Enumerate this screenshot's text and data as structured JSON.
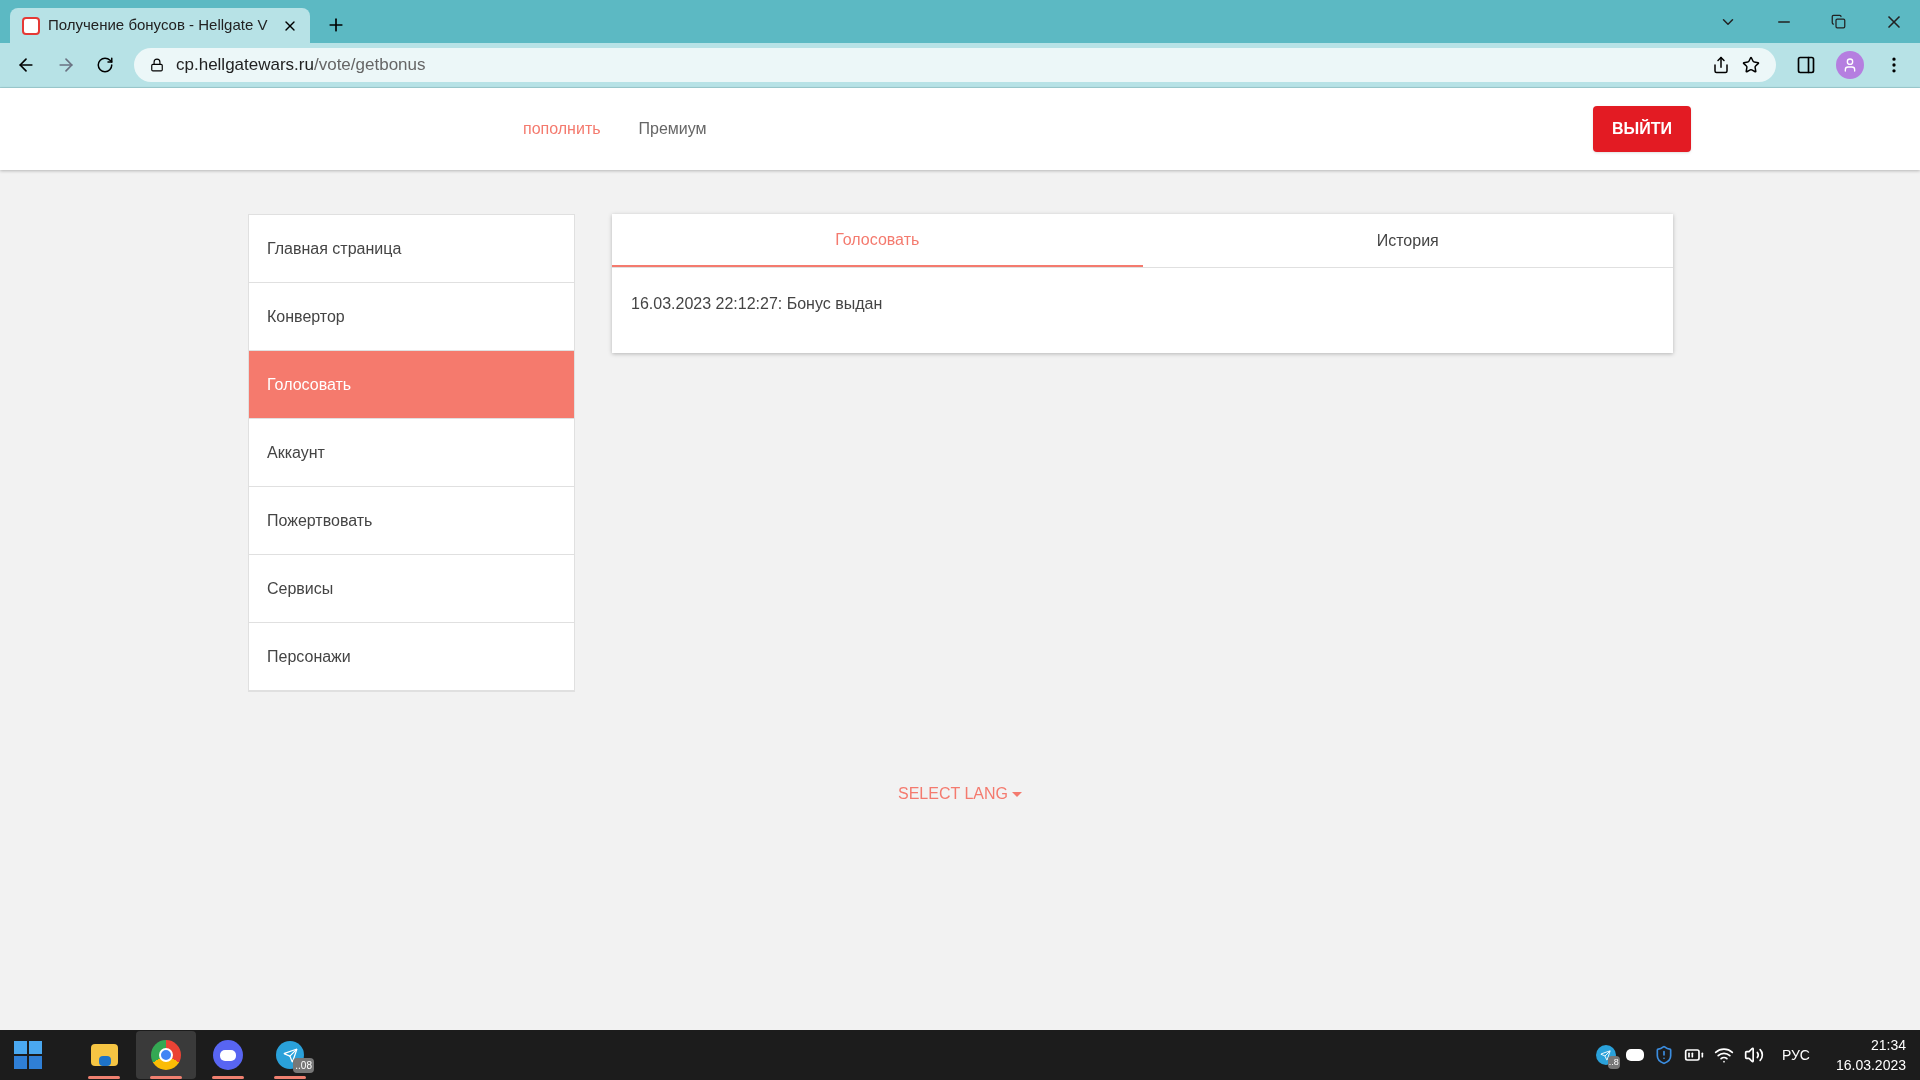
{
  "browser": {
    "tab_title": "Получение бонусов - Hellgate V",
    "url_host": "cp.hellgatewars.ru",
    "url_path": "/vote/getbonus"
  },
  "header": {
    "nav": [
      {
        "label": "пополнить",
        "selected": true
      },
      {
        "label": "Премиум",
        "selected": false
      }
    ],
    "logout": "ВЫЙТИ"
  },
  "sidebar": {
    "items": [
      {
        "label": "Главная страница",
        "selected": false
      },
      {
        "label": "Конвертор",
        "selected": false
      },
      {
        "label": "Голосовать",
        "selected": true
      },
      {
        "label": "Аккаунт",
        "selected": false
      },
      {
        "label": "Пожертвовать",
        "selected": false
      },
      {
        "label": "Сервисы",
        "selected": false
      },
      {
        "label": "Персонажи",
        "selected": false
      }
    ]
  },
  "content": {
    "tabs": [
      {
        "label": "Голосовать",
        "selected": true
      },
      {
        "label": "История",
        "selected": false
      }
    ],
    "message": "16.03.2023 22:12:27: Бонус выдан"
  },
  "footer": {
    "select_lang": "SELECT LANG"
  },
  "taskbar": {
    "apps": [
      {
        "kind": "files",
        "selected": false
      },
      {
        "kind": "chrome",
        "selected": true
      },
      {
        "kind": "discord",
        "selected": false
      },
      {
        "kind": "telegram",
        "selected": false,
        "badge": "..08"
      }
    ],
    "tray_badge": "..8",
    "language": "РУС",
    "time": "21:34",
    "date": "16.03.2023"
  }
}
